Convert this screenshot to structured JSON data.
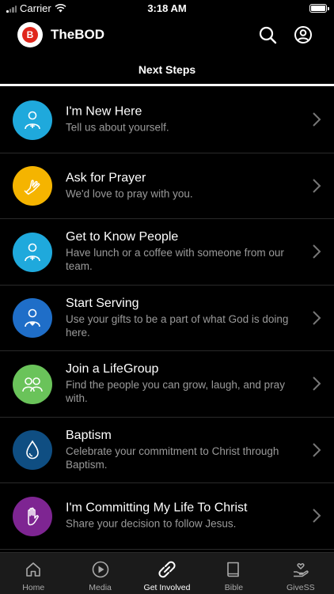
{
  "status_bar": {
    "carrier": "Carrier",
    "time": "3:18 AM"
  },
  "header": {
    "app_name": "TheBOD",
    "logo_letter": "B"
  },
  "page": {
    "title": "Next Steps"
  },
  "steps": [
    {
      "title": "I'm New Here",
      "subtitle": "Tell us about yourself.",
      "icon": "person-add-icon",
      "color": "#1fa9dc"
    },
    {
      "title": "Ask for Prayer",
      "subtitle": "We'd love to pray with you.",
      "icon": "praying-hands-icon",
      "color": "#f5b400"
    },
    {
      "title": "Get to Know People",
      "subtitle": "Have lunch or a coffee with someone from our team.",
      "icon": "person-add-icon",
      "color": "#1fa9dc"
    },
    {
      "title": "Start Serving",
      "subtitle": "Use your gifts to be a part of what God is doing here.",
      "icon": "person-heart-icon",
      "color": "#1f6ec8"
    },
    {
      "title": "Join a LifeGroup",
      "subtitle": "Find the people you can grow, laugh, and pray with.",
      "icon": "group-icon",
      "color": "#6ac35a"
    },
    {
      "title": "Baptism",
      "subtitle": "Celebrate your commitment to Christ through Baptism.",
      "icon": "water-drop-icon",
      "color": "#0f4e82"
    },
    {
      "title": "I'm Committing My Life To Christ",
      "subtitle": "Share your decision to follow Jesus.",
      "icon": "raised-hand-icon",
      "color": "#7e2592"
    }
  ],
  "tabs": [
    {
      "label": "Home",
      "icon": "home-icon"
    },
    {
      "label": "Media",
      "icon": "play-icon"
    },
    {
      "label": "Get Involved",
      "icon": "link-icon",
      "active": true
    },
    {
      "label": "Bible",
      "icon": "book-icon"
    },
    {
      "label": "GiveSS",
      "icon": "give-icon"
    }
  ]
}
